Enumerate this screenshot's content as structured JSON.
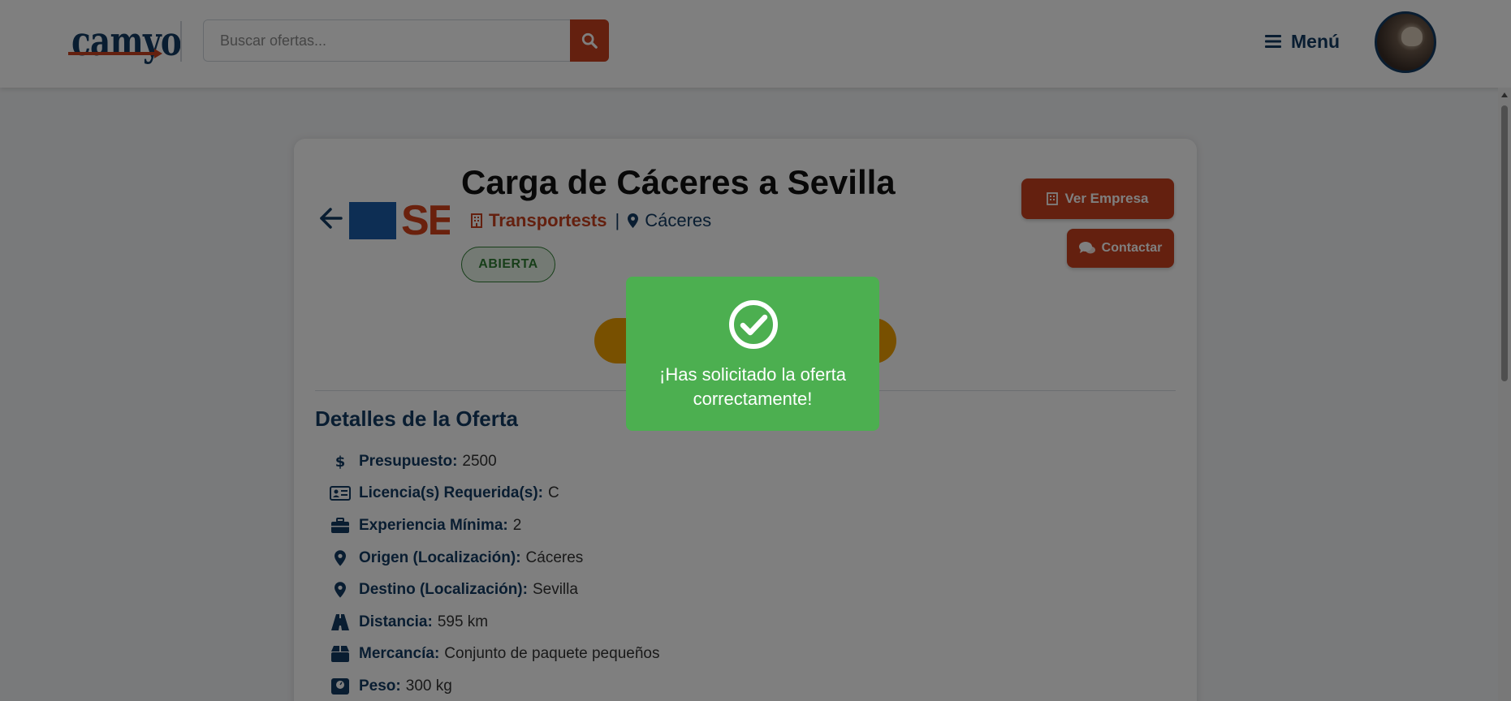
{
  "header": {
    "logo_text": "camyo",
    "search_placeholder": "Buscar ofertas...",
    "menu_label": "Menú"
  },
  "offer": {
    "title": "Carga de Cáceres a Sevilla",
    "company_logo_text": "SE",
    "company": "Transportests",
    "separator": "|",
    "location": "Cáceres",
    "status": "ABIERTA"
  },
  "actions": {
    "view_company": "Ver Empresa",
    "contact": "Contactar"
  },
  "details": {
    "section_title": "Detalles de la Oferta",
    "rows": [
      {
        "label": "Presupuesto:",
        "value": "2500",
        "icon": "dollar-icon"
      },
      {
        "label": "Licencia(s) Requerida(s):",
        "value": "C",
        "icon": "id-card-icon"
      },
      {
        "label": "Experiencia Mínima:",
        "value": "2",
        "icon": "briefcase-icon"
      },
      {
        "label": "Origen (Localización):",
        "value": "Cáceres",
        "icon": "map-marker-icon"
      },
      {
        "label": "Destino (Localización):",
        "value": "Sevilla",
        "icon": "map-marker-icon"
      },
      {
        "label": "Distancia:",
        "value": "595 km",
        "icon": "road-icon"
      },
      {
        "label": "Mercancía:",
        "value": "Conjunto de paquete pequeños",
        "icon": "box-icon"
      },
      {
        "label": "Peso:",
        "value": "300 kg",
        "icon": "weight-icon"
      }
    ]
  },
  "toast": {
    "message": "¡Has solicitado la oferta correctamente!"
  },
  "colors": {
    "brand_navy": "#123b63",
    "accent_red": "#c8401e",
    "status_green": "#2e7d32",
    "toast_green": "#4caf50",
    "apply_orange": "#f0a000"
  }
}
